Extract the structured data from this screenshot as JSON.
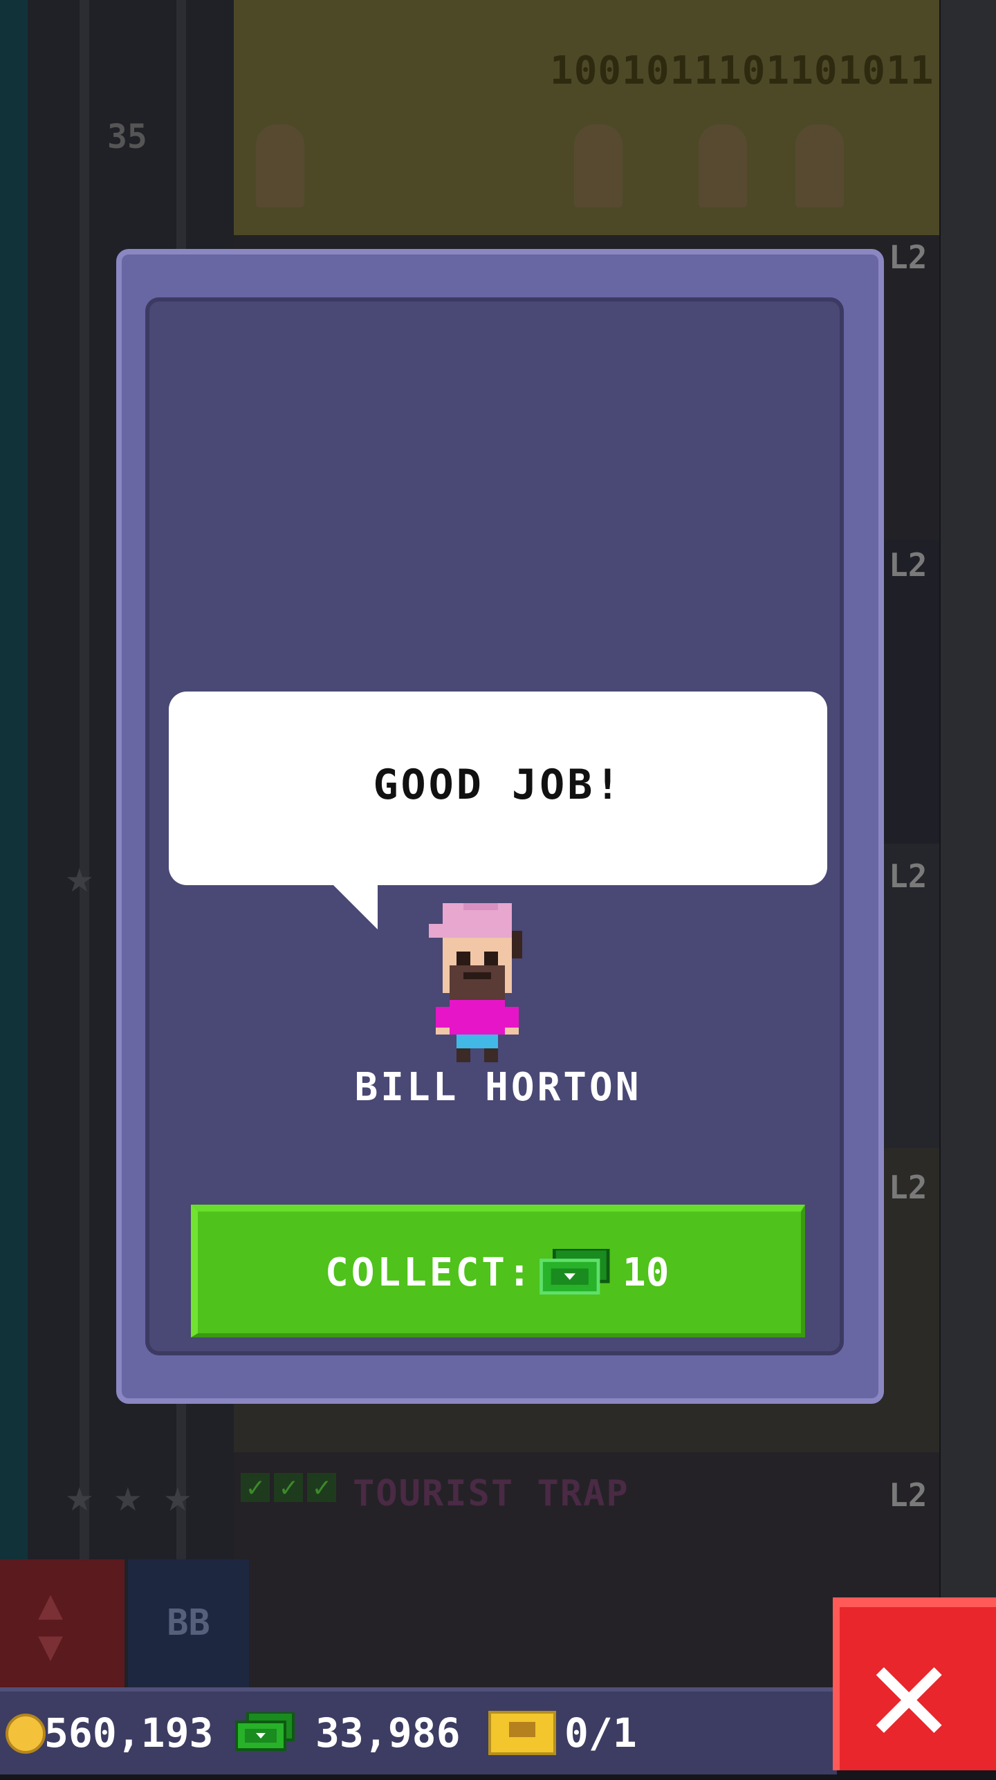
{
  "background": {
    "floor_number": "35",
    "binary_text": "1001011101101011",
    "floor_level_labels": [
      "L2",
      "L2",
      "L2",
      "L2",
      "L2"
    ],
    "floor_name": "TOURIST TRAP",
    "floor_checks": 3,
    "bb_button": "BB"
  },
  "dialog": {
    "speech": "GOOD JOB!",
    "character_name": "BILL HORTON",
    "collect_label": "COLLECT:",
    "collect_amount": "10",
    "icons": {
      "collect": "bux-icon",
      "character": "bitizen-icon"
    }
  },
  "status_bar": {
    "coins": "560,193",
    "bux": "33,986",
    "tickets": "0/1",
    "icons": {
      "coins": "coin-icon",
      "bux": "bux-icon",
      "tickets": "golden-ticket-icon"
    }
  },
  "close_button": {
    "icon": "close-icon"
  },
  "colors": {
    "dialog": "#6966a4",
    "dialog_inner": "#4a4874",
    "collect_button": "#4fc21b",
    "close_button": "#e8262c",
    "shirt": "#e616c8",
    "cap": "#e7a7cf"
  }
}
